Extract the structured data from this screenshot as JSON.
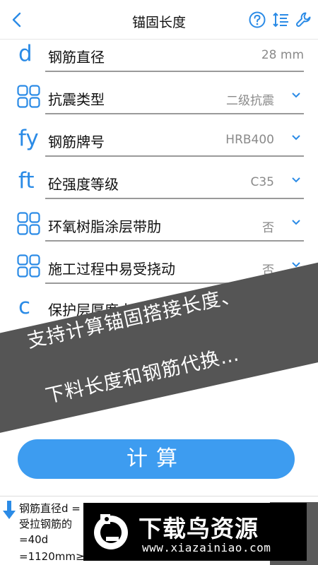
{
  "header": {
    "title": "锚固长度",
    "back_icon": "back-chevron-icon",
    "icons": [
      "help-circle-icon",
      "sort-lines-icon",
      "wrench-icon"
    ],
    "accent": "#2b8be6"
  },
  "rows": [
    {
      "symbol": "d",
      "label": "钢筋直径",
      "value": "28 mm",
      "dropdown": false
    },
    {
      "symbol": "",
      "icon": "grid-icon",
      "label": "抗震类型",
      "value": "二级抗震",
      "dropdown": true
    },
    {
      "symbol": "fy",
      "label": "钢筋牌号",
      "value": "HRB400",
      "dropdown": true
    },
    {
      "symbol": "ft",
      "label": "砼强度等级",
      "value": "C35",
      "dropdown": true
    },
    {
      "symbol": "",
      "icon": "grid-icon",
      "label": "环氧树脂涂层带肋",
      "value": "否",
      "dropdown": true
    },
    {
      "symbol": "",
      "icon": "grid-icon",
      "label": "施工过程中易受挠动",
      "value": "否",
      "dropdown": true
    },
    {
      "symbol": "c",
      "label": "保护层厚度小于5d",
      "value": "",
      "dropdown": false
    }
  ],
  "promo": {
    "line1": "支持计算锚固搭接长度、",
    "line2": "下料长度和钢筋代换…"
  },
  "calculate_label": "计算",
  "result": {
    "lines": [
      "钢筋直径d = 28 mm",
      "受拉钢筋的",
      "=40d",
      "=1120mm≥200mm"
    ]
  },
  "watermark": {
    "title": "下载鸟资源",
    "url": "www.xiazainiao.com"
  },
  "colors": {
    "button": "#3d9cf0",
    "banner": "#555555"
  }
}
